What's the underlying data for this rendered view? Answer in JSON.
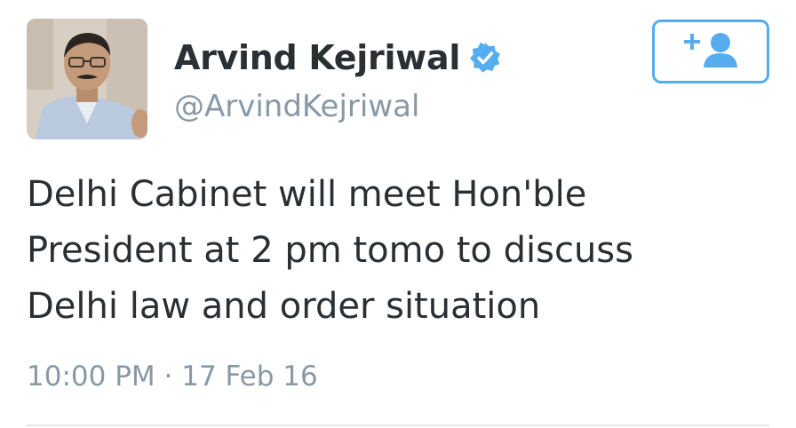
{
  "user": {
    "display_name": "Arvind Kejriwal",
    "handle": "@ArvindKejriwal",
    "verified": true
  },
  "tweet": {
    "text": "Delhi Cabinet will meet Hon'ble\nPresident at 2 pm tomo to discuss\nDelhi law and order situation",
    "time": "10:00 PM",
    "separator": "·",
    "date": "17 Feb 16"
  },
  "icons": {
    "avatar": "profile-photo",
    "verified": "verified-badge-icon",
    "follow": "add-user-icon"
  },
  "colors": {
    "accent": "#55acee",
    "text": "#292f33",
    "secondary_text": "#8899a6",
    "divider": "#e1e8ed"
  }
}
